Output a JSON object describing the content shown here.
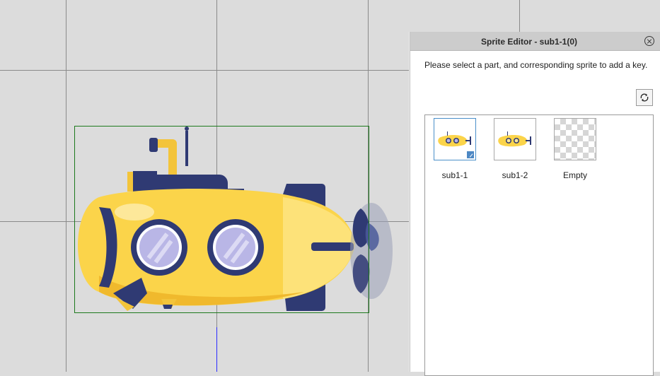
{
  "editor": {
    "title": "Sprite Editor - sub1-1(0)",
    "instructions": "Please select a part, and corresponding sprite to add a key.",
    "close_icon": "close-circle-icon",
    "refresh_icon": "refresh-icon"
  },
  "sprites": [
    {
      "label": "sub1-1",
      "selected": true,
      "badge_icon": "edit-icon"
    },
    {
      "label": "sub1-2",
      "selected": false
    },
    {
      "label": "Empty",
      "selected": false
    }
  ],
  "colors": {
    "sub_yellow": "#fbd44a",
    "sub_navy": "#2f3a73",
    "canvas_bg": "#dcdcdc",
    "bbox_green": "#1d7a1d",
    "selection_blue": "#4a8fc9"
  }
}
